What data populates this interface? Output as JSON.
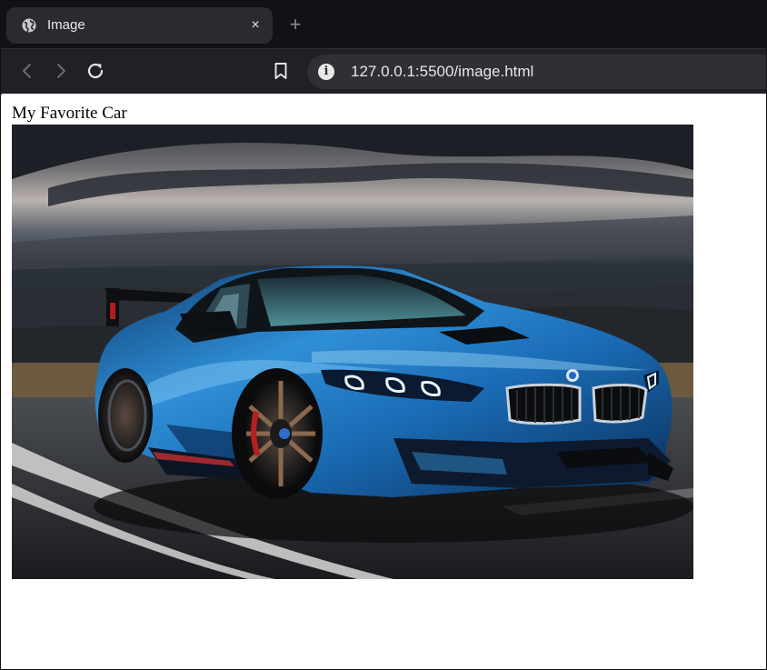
{
  "browser": {
    "tab": {
      "title": "Image",
      "close_label": "×",
      "icon": "globe-icon"
    },
    "new_tab_label": "+",
    "toolbar": {
      "back_icon": "chevron-left-icon",
      "forward_icon": "chevron-right-icon",
      "reload_icon": "reload-icon",
      "bookmark_icon": "bookmark-icon",
      "site_info_icon": "info-icon",
      "site_info_glyph": "i",
      "url_host": "127.0.0.1",
      "url_rest": ":5500/image.html"
    }
  },
  "page": {
    "caption": "My Favorite Car",
    "image_subject": "blue sports car on a road under a cloudy sky"
  },
  "colors": {
    "tabstrip_bg": "#111215",
    "tab_active_bg": "#2a2b2f",
    "toolbar_bg": "#202124",
    "omnibox_bg": "#2f3034",
    "car_blue": "#1e6fb8"
  }
}
